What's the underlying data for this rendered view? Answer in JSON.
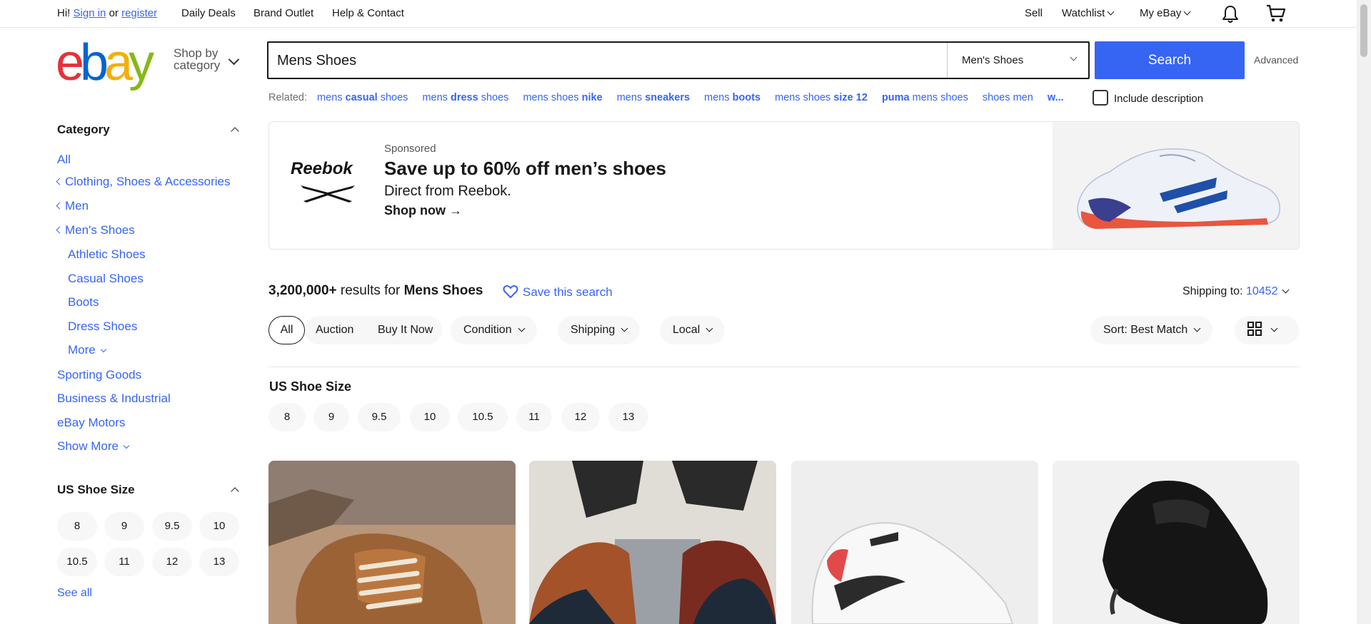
{
  "topnav": {
    "greeting": "Hi!",
    "sign_in": "Sign in",
    "or": "or",
    "register": "register",
    "daily_deals": "Daily Deals",
    "brand_outlet": "Brand Outlet",
    "help": "Help & Contact",
    "sell": "Sell",
    "watchlist": "Watchlist",
    "my_ebay": "My eBay"
  },
  "header": {
    "logo_letters": [
      "e",
      "b",
      "a",
      "y"
    ],
    "shop_by_line1": "Shop by",
    "shop_by_line2": "category",
    "search_value": "Mens Shoes",
    "category_select": "Men's Shoes",
    "search_button": "Search",
    "advanced": "Advanced"
  },
  "related": {
    "label": "Related:",
    "items": [
      {
        "pre": "mens ",
        "bold": "casual",
        "post": " shoes"
      },
      {
        "pre": "mens ",
        "bold": "dress",
        "post": " shoes"
      },
      {
        "pre": "mens shoes ",
        "bold": "nike",
        "post": ""
      },
      {
        "pre": "mens ",
        "bold": "sneakers",
        "post": ""
      },
      {
        "pre": "mens ",
        "bold": "boots",
        "post": ""
      },
      {
        "pre": "mens shoes ",
        "bold": "size 12",
        "post": ""
      },
      {
        "pre": "",
        "bold": "puma",
        "post": " mens shoes"
      },
      {
        "pre": "shoes men",
        "bold": "",
        "post": ""
      },
      {
        "pre": "w...",
        "bold": "",
        "post": ""
      }
    ],
    "include_description": "Include description"
  },
  "sidebar": {
    "category_heading": "Category",
    "all": "All",
    "crumbs": [
      "Clothing, Shoes & Accessories",
      "Men",
      "Men's Shoes"
    ],
    "subcategories": [
      "Athletic Shoes",
      "Casual Shoes",
      "Boots",
      "Dress Shoes"
    ],
    "more": "More",
    "others": [
      "Sporting Goods",
      "Business & Industrial",
      "eBay Motors"
    ],
    "show_more": "Show More",
    "size_heading": "US Shoe Size",
    "sizes": [
      "8",
      "9",
      "9.5",
      "10",
      "10.5",
      "11",
      "12",
      "13"
    ],
    "see_all": "See all"
  },
  "banner": {
    "brand": "Reebok",
    "sponsored": "Sponsored",
    "title": "Save up to 60% off men’s shoes",
    "subtitle": "Direct from Reebok.",
    "cta": "Shop now →"
  },
  "results": {
    "count": "3,200,000+",
    "results_for": "results for",
    "query": "Mens Shoes",
    "save_search": "Save this search",
    "shipping_to_label": "Shipping to:",
    "zip": "10452"
  },
  "filters": {
    "all": "All",
    "auction": "Auction",
    "buy_it_now": "Buy It Now",
    "condition": "Condition",
    "shipping": "Shipping",
    "local": "Local",
    "sort": "Sort: Best Match"
  },
  "size_filter": {
    "heading": "US Shoe Size",
    "sizes": [
      "8",
      "9",
      "9.5",
      "10",
      "10.5",
      "11",
      "12",
      "13"
    ]
  },
  "colors": {
    "accent": "#3665f3",
    "logo_e": "#e53238",
    "logo_b": "#0064d2",
    "logo_a": "#f5af02",
    "logo_y": "#86b817"
  }
}
